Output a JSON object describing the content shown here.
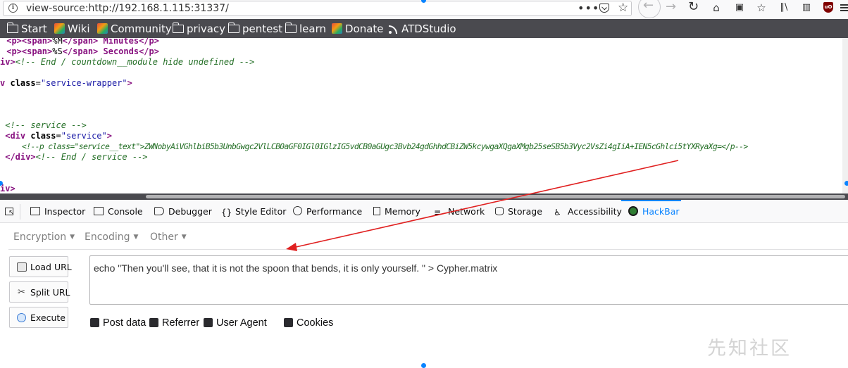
{
  "browser": {
    "url": "view-source:http://192.168.1.115:31337/",
    "page_actions_icon": "ellipsis-icon",
    "toolbar_icons": [
      "back-icon",
      "forward-icon",
      "reload-icon",
      "home-icon",
      "screenshot-icon",
      "bookmark-star-icon",
      "library-icon",
      "sidebar-icon",
      "ublock-icon",
      "menu-icon"
    ],
    "ublock_label": "uO"
  },
  "bookmarks": [
    {
      "label": "Start",
      "icon": "folder-icon"
    },
    {
      "label": "Wiki",
      "icon": "kali-icon"
    },
    {
      "label": "Community",
      "icon": "kali-icon"
    },
    {
      "label": "privacy",
      "icon": "folder-icon"
    },
    {
      "label": "pentest",
      "icon": "folder-icon"
    },
    {
      "label": "learn",
      "icon": "folder-icon"
    },
    {
      "label": "Donate",
      "icon": "kali-icon"
    },
    {
      "label": "ATDStudio",
      "icon": "rss-icon"
    }
  ],
  "source": {
    "line1": {
      "open_tag": " <p><span>",
      "content": "%M",
      "close": "</span>",
      "rest": " Minutes</p>"
    },
    "line2": {
      "open_tag": " <p><span>",
      "content": "%S",
      "close": "</span>",
      "rest": " Seconds</p>"
    },
    "line3": {
      "tag": "iv>",
      "comment": "<!-- End / countdown__module hide undefined -->"
    },
    "line4": {
      "prefix": "v ",
      "attr": "class",
      "eq": "=",
      "value": "\"service-wrapper\"",
      "end": ">"
    },
    "line5": {
      "comment": " <!-- service -->"
    },
    "line6": {
      "open": " <div ",
      "attr": "class",
      "eq": "=",
      "value": "\"service\"",
      "end": ">"
    },
    "line7": {
      "comment": "     <!--p class=\"service__text\">ZWNobyAiVGhlbiB5b3UnbGwgc2VlLCB0aGF0IGl0IGlzIG5vdCB0aGUgc3Bvb24gdGhhdCBiZW5kcywgaXQgaXMgb25seSB5b3Vyc2VsZi4gIiA+IEN5cGhlci5tYXRyaXg=</p-->"
    },
    "line8": {
      "tag": " </div>",
      "comment": "<!-- End / service -->"
    },
    "line9": {
      "tag": "iv>"
    }
  },
  "devtools": {
    "tabs": [
      {
        "label": "Inspector",
        "icon": "inspector-icon"
      },
      {
        "label": "Console",
        "icon": "console-icon"
      },
      {
        "label": "Debugger",
        "icon": "debugger-icon"
      },
      {
        "label": "Style Editor",
        "icon": "style-editor-icon"
      },
      {
        "label": "Performance",
        "icon": "performance-icon"
      },
      {
        "label": "Memory",
        "icon": "memory-icon"
      },
      {
        "label": "Network",
        "icon": "network-icon"
      },
      {
        "label": "Storage",
        "icon": "storage-icon"
      },
      {
        "label": "Accessibility",
        "icon": "accessibility-icon"
      },
      {
        "label": "HackBar",
        "icon": "hackbar-icon"
      }
    ],
    "active_tab": "HackBar",
    "accent_color": "#0a84ff"
  },
  "hackbar": {
    "menus": [
      {
        "label": "Encryption"
      },
      {
        "label": "Encoding"
      },
      {
        "label": "Other"
      }
    ],
    "buttons": [
      {
        "label": "Load URL",
        "icon": "load-url-icon"
      },
      {
        "label": "Split URL",
        "icon": "scissors-icon"
      },
      {
        "label": "Execute",
        "icon": "execute-icon"
      }
    ],
    "textarea_value": "echo \"Then you'll see, that it is not the spoon that bends, it is only yourself. \" > Cypher.matrix",
    "checkboxes": [
      {
        "label": "Post data",
        "checked": false
      },
      {
        "label": "Referrer",
        "checked": false
      },
      {
        "label": "User Agent",
        "checked": false
      },
      {
        "label": "Cookies",
        "checked": false
      }
    ]
  },
  "annotation": {
    "color": "#e02020",
    "from": "encoded comment",
    "to": "hackbar textarea"
  },
  "watermark": "先知社区"
}
